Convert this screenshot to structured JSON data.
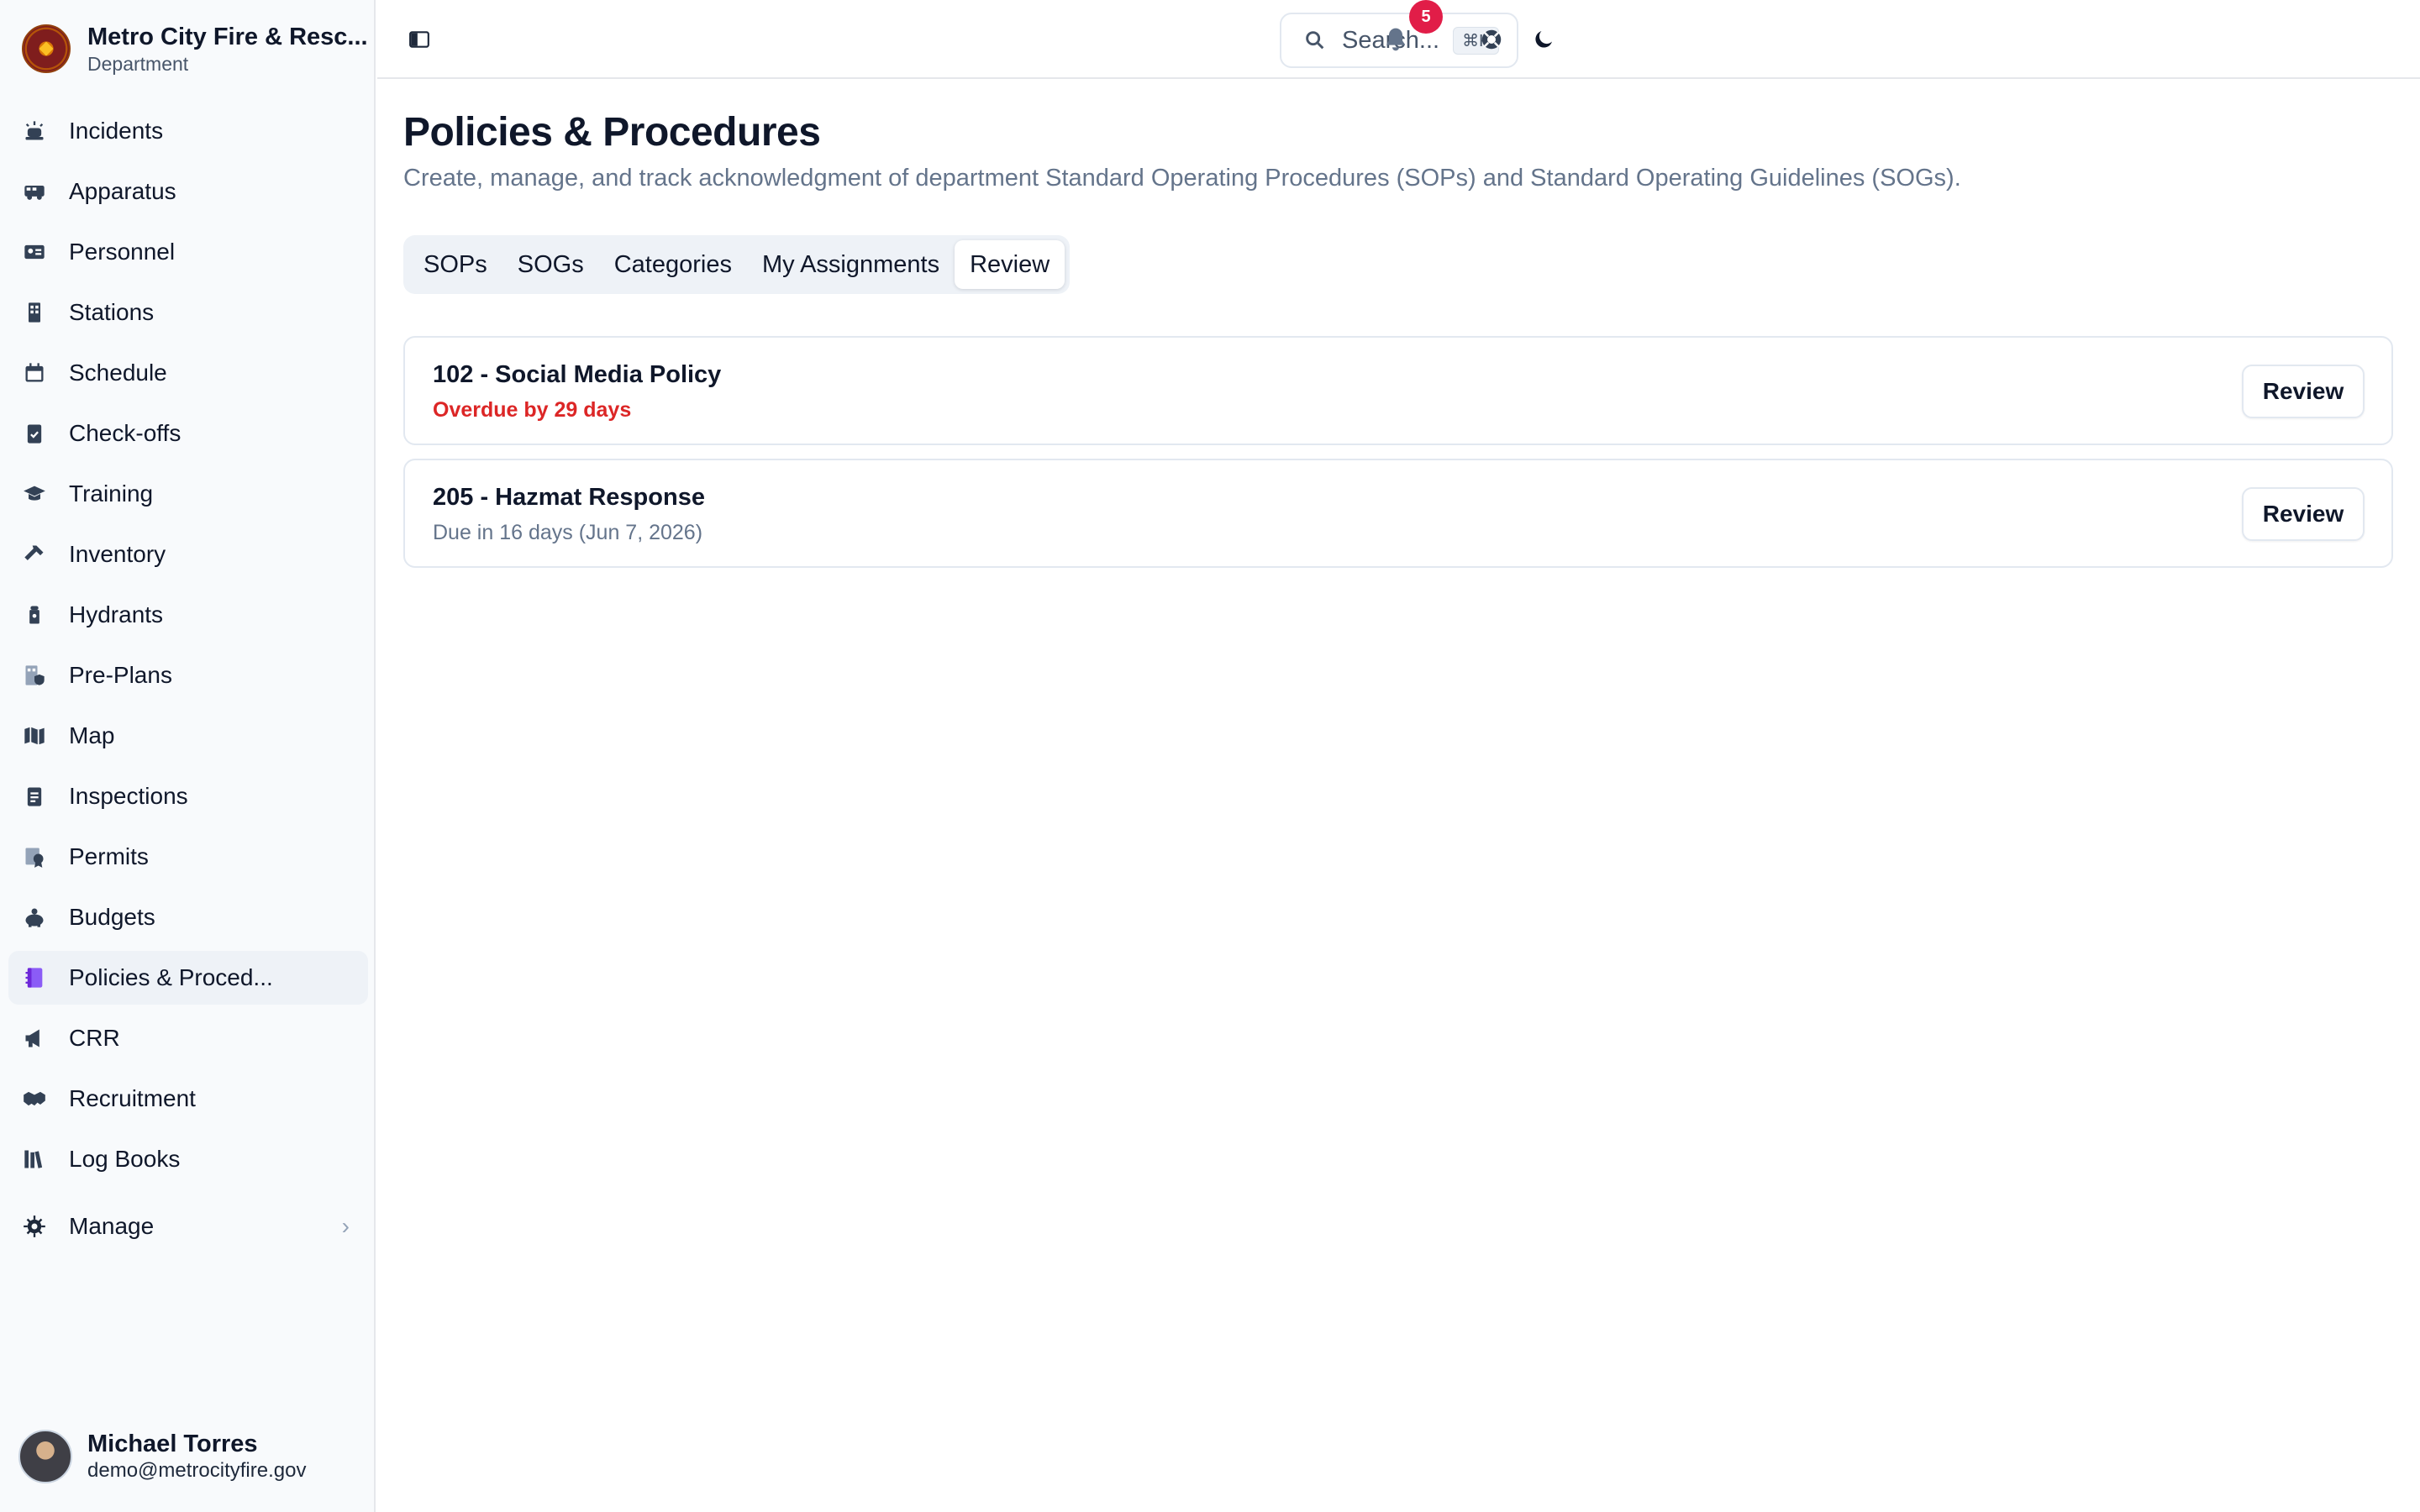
{
  "brand": {
    "title": "Metro City Fire & Resc...",
    "subtitle": "Department"
  },
  "sidebar": {
    "items": [
      {
        "label": "Incidents",
        "icon": "siren-icon"
      },
      {
        "label": "Apparatus",
        "icon": "truck-icon"
      },
      {
        "label": "Personnel",
        "icon": "id-card-icon"
      },
      {
        "label": "Stations",
        "icon": "building-icon"
      },
      {
        "label": "Schedule",
        "icon": "calendar-icon"
      },
      {
        "label": "Check-offs",
        "icon": "clipboard-check-icon"
      },
      {
        "label": "Training",
        "icon": "graduation-cap-icon"
      },
      {
        "label": "Inventory",
        "icon": "wrench-icon"
      },
      {
        "label": "Hydrants",
        "icon": "hydrant-icon"
      },
      {
        "label": "Pre-Plans",
        "icon": "building-shield-icon"
      },
      {
        "label": "Map",
        "icon": "map-icon"
      },
      {
        "label": "Inspections",
        "icon": "clipboard-icon"
      },
      {
        "label": "Permits",
        "icon": "certificate-icon"
      },
      {
        "label": "Budgets",
        "icon": "piggy-bank-icon"
      },
      {
        "label": "Policies & Proced...",
        "icon": "book-icon",
        "active": true
      },
      {
        "label": "CRR",
        "icon": "megaphone-icon"
      },
      {
        "label": "Recruitment",
        "icon": "handshake-icon"
      },
      {
        "label": "Log Books",
        "icon": "books-icon"
      }
    ],
    "manage": {
      "label": "Manage",
      "icon": "gear-icon"
    }
  },
  "user": {
    "name": "Michael Torres",
    "email": "demo@metrocityfire.gov"
  },
  "topbar": {
    "search_placeholder": "Search...",
    "search_shortcut": "⌘K",
    "notification_count": "5"
  },
  "page": {
    "title": "Policies & Procedures",
    "description": "Create, manage, and track acknowledgment of department Standard Operating Procedures (SOPs) and Standard Operating Guidelines (SOGs)."
  },
  "tabs": [
    {
      "label": "SOPs"
    },
    {
      "label": "SOGs"
    },
    {
      "label": "Categories"
    },
    {
      "label": "My Assignments"
    },
    {
      "label": "Review",
      "active": true
    }
  ],
  "reviews": [
    {
      "title": "102 - Social Media Policy",
      "status": "Overdue by 29 days",
      "status_type": "overdue",
      "button": "Review"
    },
    {
      "title": "205 - Hazmat Response",
      "status": "Due in 16 days (Jun 7, 2026)",
      "status_type": "due",
      "button": "Review"
    }
  ],
  "colors": {
    "accent": "#7c3aed",
    "danger": "#dc2626",
    "badge": "#e11d48"
  }
}
